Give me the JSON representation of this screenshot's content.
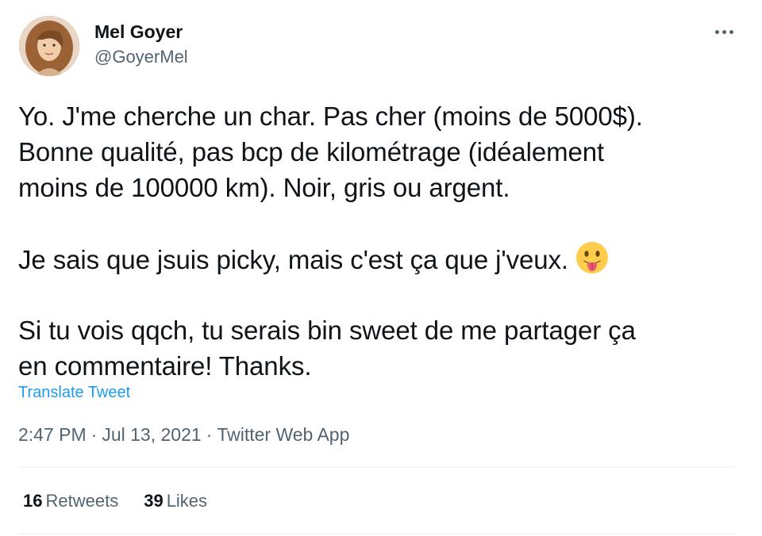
{
  "author": {
    "display_name": "Mel Goyer",
    "handle": "@GoyerMel"
  },
  "more_icon": "more-horizontal-icon",
  "tweet": {
    "para1_line1": "Yo. J'me cherche un char. Pas cher (moins de 5000$).",
    "para1_line2": "Bonne qualité, pas bcp de kilométrage (idéalement",
    "para1_line3": "moins de 100000 km). Noir, gris ou argent.",
    "para2": "Je sais que jsuis picky, mais c'est ça que j'veux.",
    "para2_emoji": "face-with-tongue-emoji",
    "para3_line1": "Si tu vois qqch, tu serais bin sweet de me partager ça",
    "para3_line2": "en commentaire! Thanks."
  },
  "translate_label": "Translate Tweet",
  "meta": {
    "time": "2:47 PM",
    "separator": "·",
    "date": "Jul 13, 2021",
    "source": "Twitter Web App"
  },
  "stats": {
    "retweets_count": "16",
    "retweets_label": "Retweets",
    "likes_count": "39",
    "likes_label": "Likes"
  },
  "colors": {
    "accent": "#1d9bf0",
    "secondary_text": "#536471",
    "primary_text": "#0f1419",
    "divider": "#eff3f4"
  }
}
